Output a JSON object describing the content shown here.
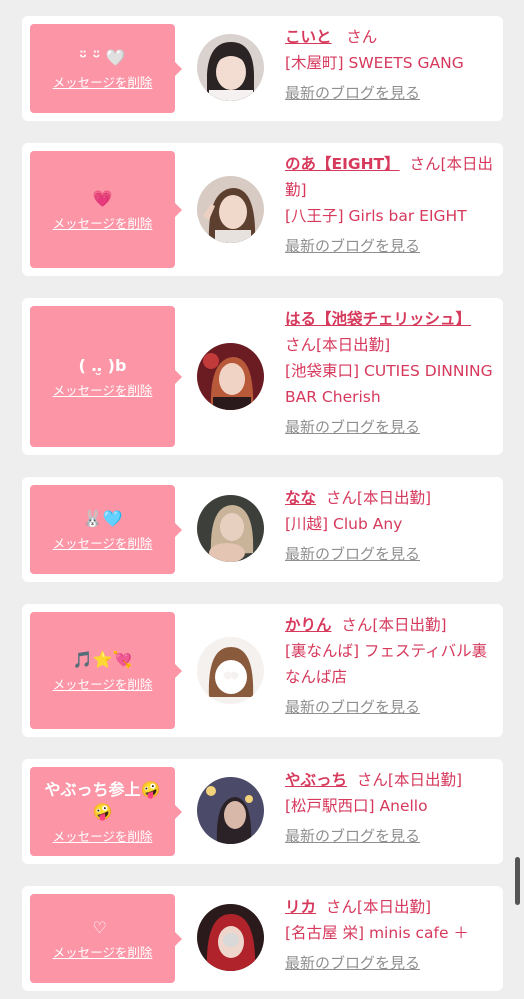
{
  "cards": [
    {
      "message": "ᵕ̈ ᵕ̈ 🤍",
      "delete_label": "メッセージを削除",
      "name": "こいと",
      "honorific": "さん",
      "status": "",
      "shop": "[木屋町] SWEETS GANG",
      "blog_label": "最新のブログを見る"
    },
    {
      "message": "💗",
      "delete_label": "メッセージを削除",
      "name": "のあ【EIGHT】",
      "honorific": "さん",
      "status": "[本日出勤]",
      "shop": "[八王子] Girls bar EIGHT",
      "blog_label": "最新のブログを見る"
    },
    {
      "message": "( ‥̮ )b",
      "delete_label": "メッセージを削除",
      "name": "はる【池袋チェリッシュ】",
      "honorific": "さん",
      "status": "[本日出勤]",
      "shop": "[池袋東口] CUTIES DINNING BAR Cherish",
      "blog_label": "最新のブログを見る"
    },
    {
      "message": "🐰🩵",
      "delete_label": "メッセージを削除",
      "name": "なな",
      "honorific": "さん",
      "status": "[本日出勤]",
      "shop": "[川越] Club Any",
      "blog_label": "最新のブログを見る"
    },
    {
      "message": "🎵⭐💘",
      "delete_label": "メッセージを削除",
      "name": "かりん",
      "honorific": "さん",
      "status": "[本日出勤]",
      "shop": "[裏なんば] フェスティバル裏なんば店",
      "blog_label": "最新のブログを見る"
    },
    {
      "message": "やぶっち参上🤪🤪",
      "delete_label": "メッセージを削除",
      "name": "やぶっち",
      "honorific": "さん",
      "status": "[本日出勤]",
      "shop": "[松戸駅西口] Anello",
      "blog_label": "最新のブログを見る"
    },
    {
      "message": "♡ ︎",
      "delete_label": "メッセージを削除",
      "name": "リカ",
      "honorific": "さん",
      "status": "[本日出勤]",
      "shop": "[名古屋 栄] minis cafe ＋",
      "blog_label": "最新のブログを見る"
    }
  ],
  "colors": {
    "bubble": "#fc95a6",
    "name": "#d6395c",
    "blog_link": "#8f8f8f",
    "background": "#eeeeee"
  }
}
